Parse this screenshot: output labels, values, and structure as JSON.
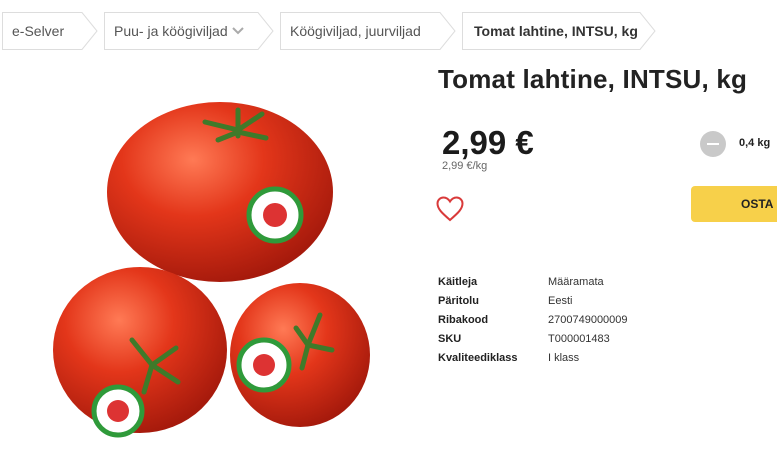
{
  "breadcrumb": [
    {
      "label": "e-Selver"
    },
    {
      "label": "Puu- ja köögiviljad"
    },
    {
      "label": "Köögiviljad, juurviljad"
    },
    {
      "label": "Tomat lahtine, INTSU, kg"
    }
  ],
  "product": {
    "title": "Tomat lahtine, INTSU, kg",
    "price": "2,99 €",
    "unit_price": "2,99 €/kg",
    "quantity": "0,4 kg",
    "buy_label": "OSTA",
    "attributes": [
      {
        "key": "Käitleja",
        "value": "Määramata"
      },
      {
        "key": "Päritolu",
        "value": "Eesti"
      },
      {
        "key": "Ribakood",
        "value": "2700749000009"
      },
      {
        "key": "SKU",
        "value": "T000001483"
      },
      {
        "key": "Kvaliteediklass",
        "value": "I klass"
      }
    ]
  },
  "colors": {
    "accent": "#f7d04a",
    "favorite": "#d93a3a",
    "tomato": "#e03a1e"
  },
  "icons": {
    "dropdown": "chevron-down-icon",
    "favorite": "heart-icon",
    "decrease": "minus-icon"
  }
}
